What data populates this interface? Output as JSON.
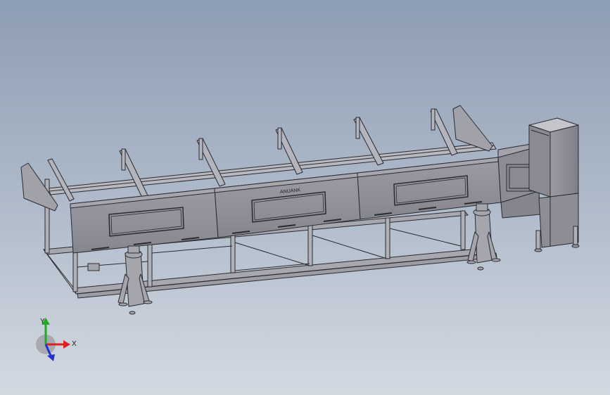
{
  "viewport": {
    "background_top": "#8d9db3",
    "background_bottom": "#d3d9e1"
  },
  "model": {
    "brand_text": "ANUANK",
    "body_color": "#8f8f99",
    "frame_color": "#b3b3bb",
    "edge_color": "#2a2a30"
  },
  "triad": {
    "y_label": "Y",
    "x_label": "X",
    "y_color": "#22aa22",
    "x_color": "#dd2222",
    "z_color": "#2233cc"
  }
}
